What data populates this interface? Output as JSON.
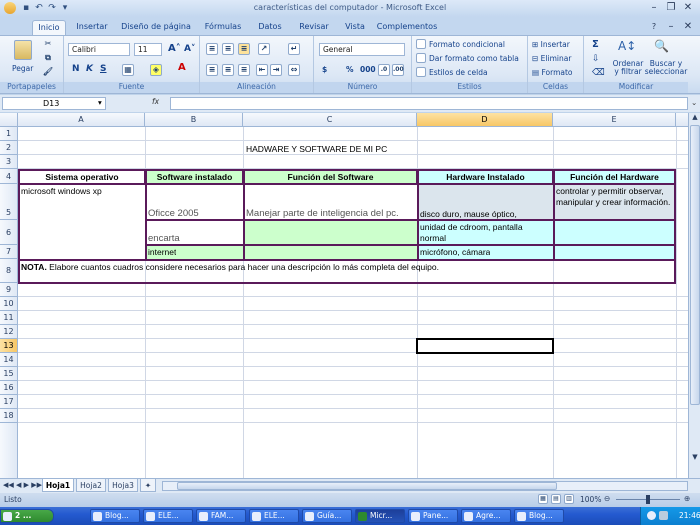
{
  "window": {
    "title": "características del computador - Microsoft Excel"
  },
  "tabs": [
    "Inicio",
    "Insertar",
    "Diseño de página",
    "Fórmulas",
    "Datos",
    "Revisar",
    "Vista",
    "Complementos"
  ],
  "ribbon": {
    "groups": {
      "clipboard": "Portapapeles",
      "font": "Fuente",
      "alignment": "Alineación",
      "number": "Número",
      "styles": "Estilos",
      "cells": "Celdas",
      "modify": "Modificar"
    },
    "paste_label": "Pegar",
    "font_name": "Calibri",
    "font_size": "11",
    "number_format": "General",
    "cond_format": "Formato condicional",
    "table_format": "Dar formato como tabla",
    "cell_styles": "Estilos de celda",
    "insert": "Insertar",
    "delete": "Eliminar",
    "format": "Formato",
    "sort_filter": "Ordenar y filtrar",
    "find_select": "Buscar y seleccionar",
    "bold": "N",
    "italic": "K",
    "underline": "S",
    "currency": "$",
    "percent": "%",
    "thousands": "000"
  },
  "formula_bar": {
    "name_box": "D13",
    "fx": "fx",
    "value": ""
  },
  "columns": [
    "A",
    "B",
    "C",
    "D",
    "E"
  ],
  "rows": [
    "1",
    "2",
    "3",
    "4",
    "5",
    "6",
    "7",
    "8",
    "9",
    "10",
    "11",
    "12",
    "13",
    "14",
    "15",
    "16",
    "17",
    "18"
  ],
  "cells": {
    "C2": "HADWARE Y SOFTWARE  DE MI PC",
    "A4": "Sistema operativo",
    "B4": "Software instalado",
    "C4": "Función del Software",
    "D4": "Hardware Instalado",
    "E4": "Función del Hardware",
    "A5": "microsoft windows xp",
    "B5": "Oficce 2005",
    "C5": "Manejar parte de inteligencia del pc.",
    "D5": "disco duro, mause óptico,",
    "E5a": "controlar y permitir observar,",
    "E5b": "manipular y crear información.",
    "B6": "encarta",
    "D6a": "unidad de cdroom, pantalla",
    "D6b": "normal",
    "B7": "internet",
    "D7": "micrófono, cámara",
    "A8_bold": "NOTA.",
    "A8_text": " Elabore cuantos cuadros considere necesarios para hacer una descripción lo más completa del equipo."
  },
  "sheet_tabs": [
    "Hoja1",
    "Hoja2",
    "Hoja3"
  ],
  "status": {
    "ready": "Listo",
    "zoom": "100%"
  },
  "taskbar": {
    "start": "2 ...",
    "items": [
      "Blog...",
      "ELE...",
      "FAM...",
      "ELE...",
      "Guía...",
      "Micr...",
      "Pane...",
      "Agre...",
      "Blog..."
    ],
    "clock": "21:46"
  },
  "colors": {
    "header_fill": "#ccffcc",
    "hw_fill": "#ccffff",
    "border": "#5a1a5a",
    "selected_col": "#f7c766"
  }
}
